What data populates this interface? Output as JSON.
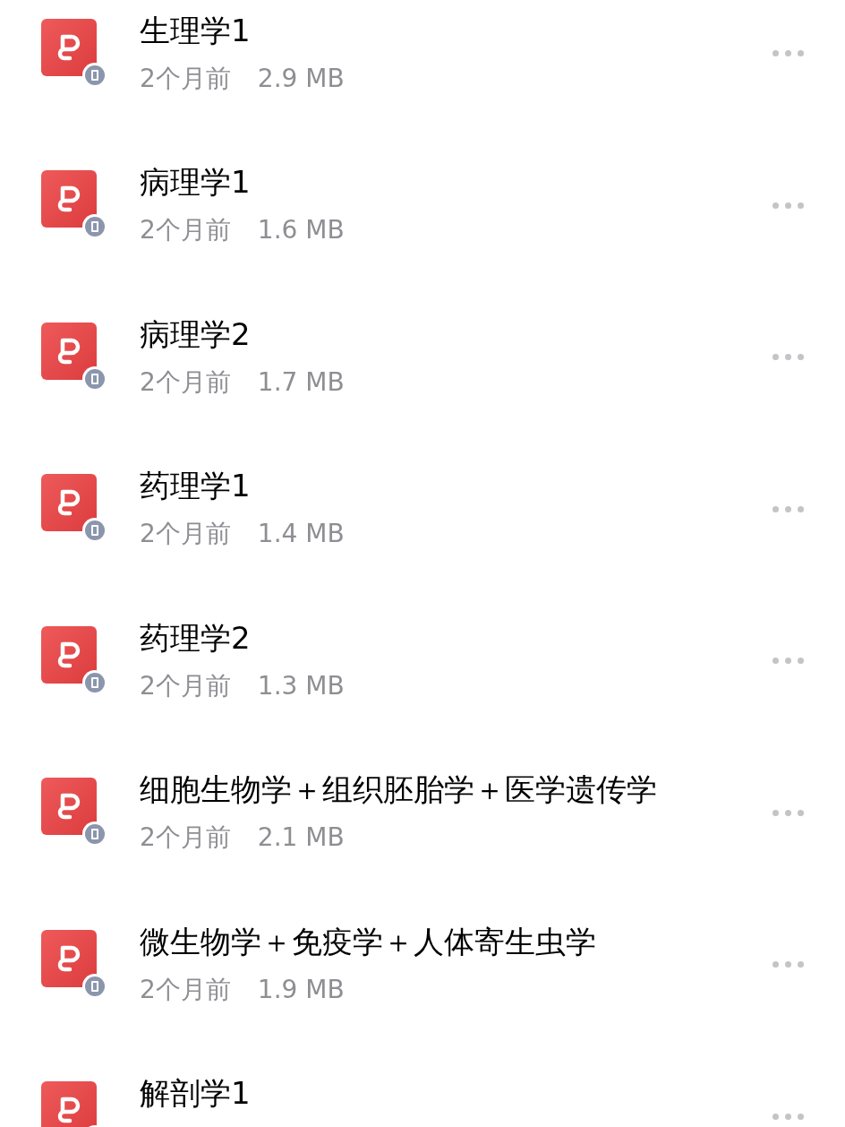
{
  "files": [
    {
      "name": "生理学1",
      "time": "2个月前",
      "size": "2.9 MB"
    },
    {
      "name": "病理学1",
      "time": "2个月前",
      "size": "1.6 MB"
    },
    {
      "name": "病理学2",
      "time": "2个月前",
      "size": "1.7 MB"
    },
    {
      "name": "药理学1",
      "time": "2个月前",
      "size": "1.4 MB"
    },
    {
      "name": "药理学2",
      "time": "2个月前",
      "size": "1.3 MB"
    },
    {
      "name": "细胞生物学＋组织胚胎学＋医学遗传学",
      "time": "2个月前",
      "size": "2.1 MB"
    },
    {
      "name": "微生物学＋免疫学＋人体寄生虫学",
      "time": "2个月前",
      "size": "1.9 MB"
    },
    {
      "name": "解剖学1"
    }
  ]
}
